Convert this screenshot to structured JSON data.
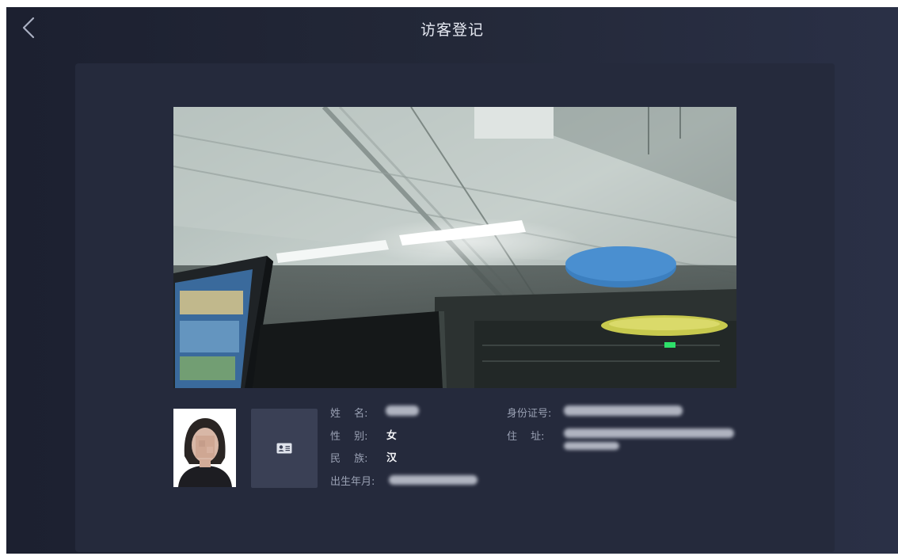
{
  "header": {
    "title": "访客登记",
    "back_icon": "chevron-left-icon"
  },
  "colors": {
    "background": "#232838",
    "card": "#252a3c",
    "tile": "#3a4055",
    "text_primary": "#f4f5f8",
    "text_label": "#9aa1b4"
  },
  "camera": {
    "green_sign": "出"
  },
  "id_card_icon": "id-card-icon",
  "visitor": {
    "name_label": "姓　 名:",
    "gender_label": "性　 别:",
    "gender_value": "女",
    "ethnicity_label": "民　 族:",
    "ethnicity_value": "汉",
    "birth_label": "出生年月:",
    "id_number_label": "身份证号:",
    "address_label": "住　 址:"
  }
}
